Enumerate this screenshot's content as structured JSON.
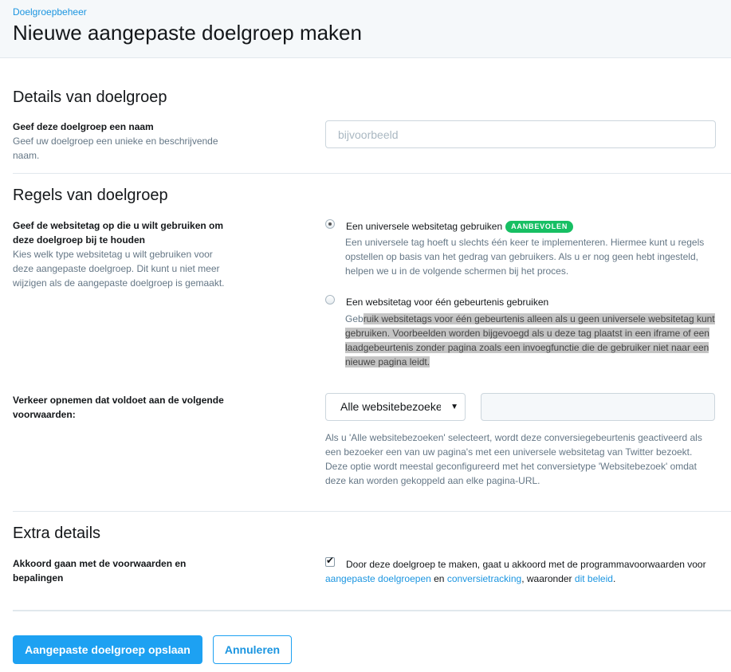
{
  "header": {
    "breadcrumb": "Doelgroepbeheer",
    "title": "Nieuwe aangepaste doelgroep maken"
  },
  "details": {
    "section_title": "Details van doelgroep",
    "name_label": "Geef deze doelgroep een naam",
    "name_help": "Geef uw doelgroep een unieke en beschrijvende naam.",
    "name_placeholder": "bijvoorbeeld",
    "name_value": ""
  },
  "rules": {
    "section_title": "Regels van doelgroep",
    "tag_label": "Geef de websitetag op die u wilt gebruiken om deze doelgroep bij te houden",
    "tag_help": "Kies welk type websitetag u wilt gebruiken voor deze aangepaste doelgroep. Dit kunt u niet meer wijzigen als de aangepaste doelgroep is gemaakt.",
    "options": [
      {
        "title": "Een universele websitetag gebruiken",
        "badge": "AANBEVOLEN",
        "desc": "Een universele tag hoeft u slechts één keer te implementeren. Hiermee kunt u regels opstellen op basis van het gedrag van gebruikers. Als u er nog geen hebt ingesteld, helpen we u in de volgende schermen bij het proces.",
        "selected": true
      },
      {
        "title": "Een websitetag voor één gebeurtenis gebruiken",
        "desc_plain": "Geb",
        "desc_highlight": "ruik websitetags voor één gebeurtenis alleen als u geen universele websitetag kunt gebruiken. Voorbeelden worden bijgevoegd als u deze tag plaatst in een iframe of een laadgebeurtenis zonder pagina zoals een invoegfunctie die de gebruiker niet naar een nieuwe pagina leidt.",
        "selected": false
      }
    ],
    "traffic_label": "Verkeer opnemen dat voldoet aan de volgende voorwaarden:",
    "traffic_select": "Alle websitebezoeken",
    "traffic_url": "",
    "traffic_help": "Als u 'Alle websitebezoeken' selecteert, wordt deze conversiegebeurtenis geactiveerd als een bezoeker een van uw pagina's met een universele websitetag van Twitter bezoekt. Deze optie wordt meestal geconfigureerd met het conversietype 'Websitebezoek' omdat deze kan worden gekoppeld aan elke pagina-URL."
  },
  "extra": {
    "section_title": "Extra details",
    "terms_label": "Akkoord gaan met de voorwaarden en bepalingen",
    "terms_checked": true,
    "terms_text_1": "Door deze doelgroep te maken, gaat u akkoord met de programmavoorwaarden voor ",
    "terms_link_1": "aangepaste doelgroepen",
    "terms_text_2": " en ",
    "terms_link_2": "conversietracking",
    "terms_text_3": ", waaronder ",
    "terms_link_3": "dit beleid",
    "terms_text_4": "."
  },
  "actions": {
    "save_label": "Aangepaste doelgroep opslaan",
    "cancel_label": "Annuleren"
  },
  "colors": {
    "accent": "#1da1f2",
    "link": "#1b95e0",
    "badge": "#17bf63"
  }
}
